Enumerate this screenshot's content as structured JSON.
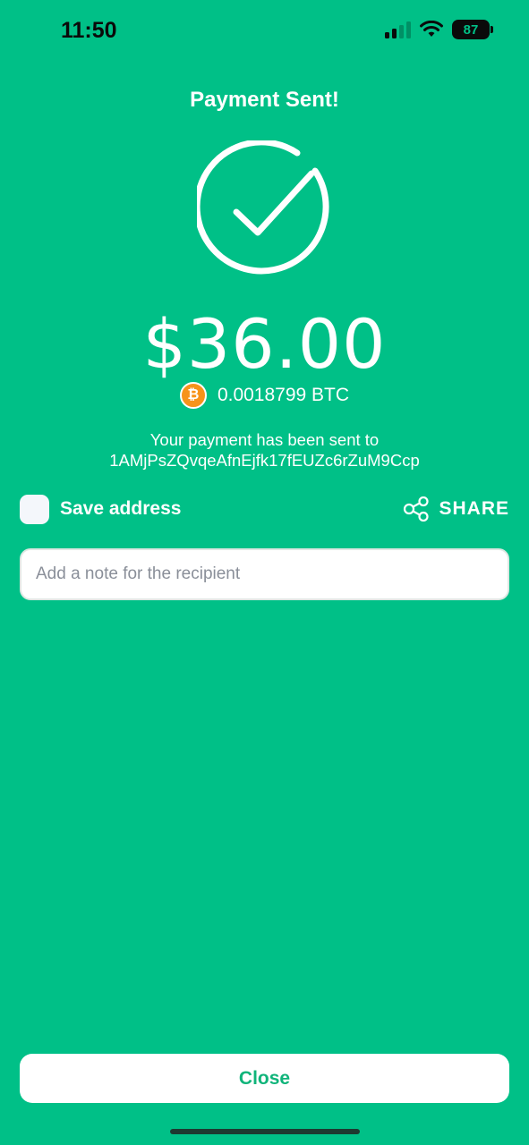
{
  "status_bar": {
    "time": "11:50",
    "battery": "87",
    "icons": [
      "signal-icon",
      "wifi-icon",
      "battery-icon"
    ]
  },
  "header": {
    "title": "Payment Sent!"
  },
  "success": {
    "icon": "checkmark-circle-icon"
  },
  "payment": {
    "amount": "$36.00",
    "btc_icon": "bitcoin-icon",
    "btc_amount": "0.0018799 BTC",
    "sent_line": "Your payment has been sent to",
    "address": "1AMjPsZQvqeAfnEjfk17fEUZc6rZuM9Ccp"
  },
  "actions": {
    "save_label": "Save address",
    "save_checked": false,
    "share_label": "SHARE",
    "share_icon": "share-icon"
  },
  "note": {
    "value": "",
    "placeholder": "Add a note for the recipient"
  },
  "footer": {
    "close_label": "Close"
  },
  "colors": {
    "background": "#00c087",
    "accent_text": "#10b47a",
    "bitcoin": "#f7931a"
  }
}
